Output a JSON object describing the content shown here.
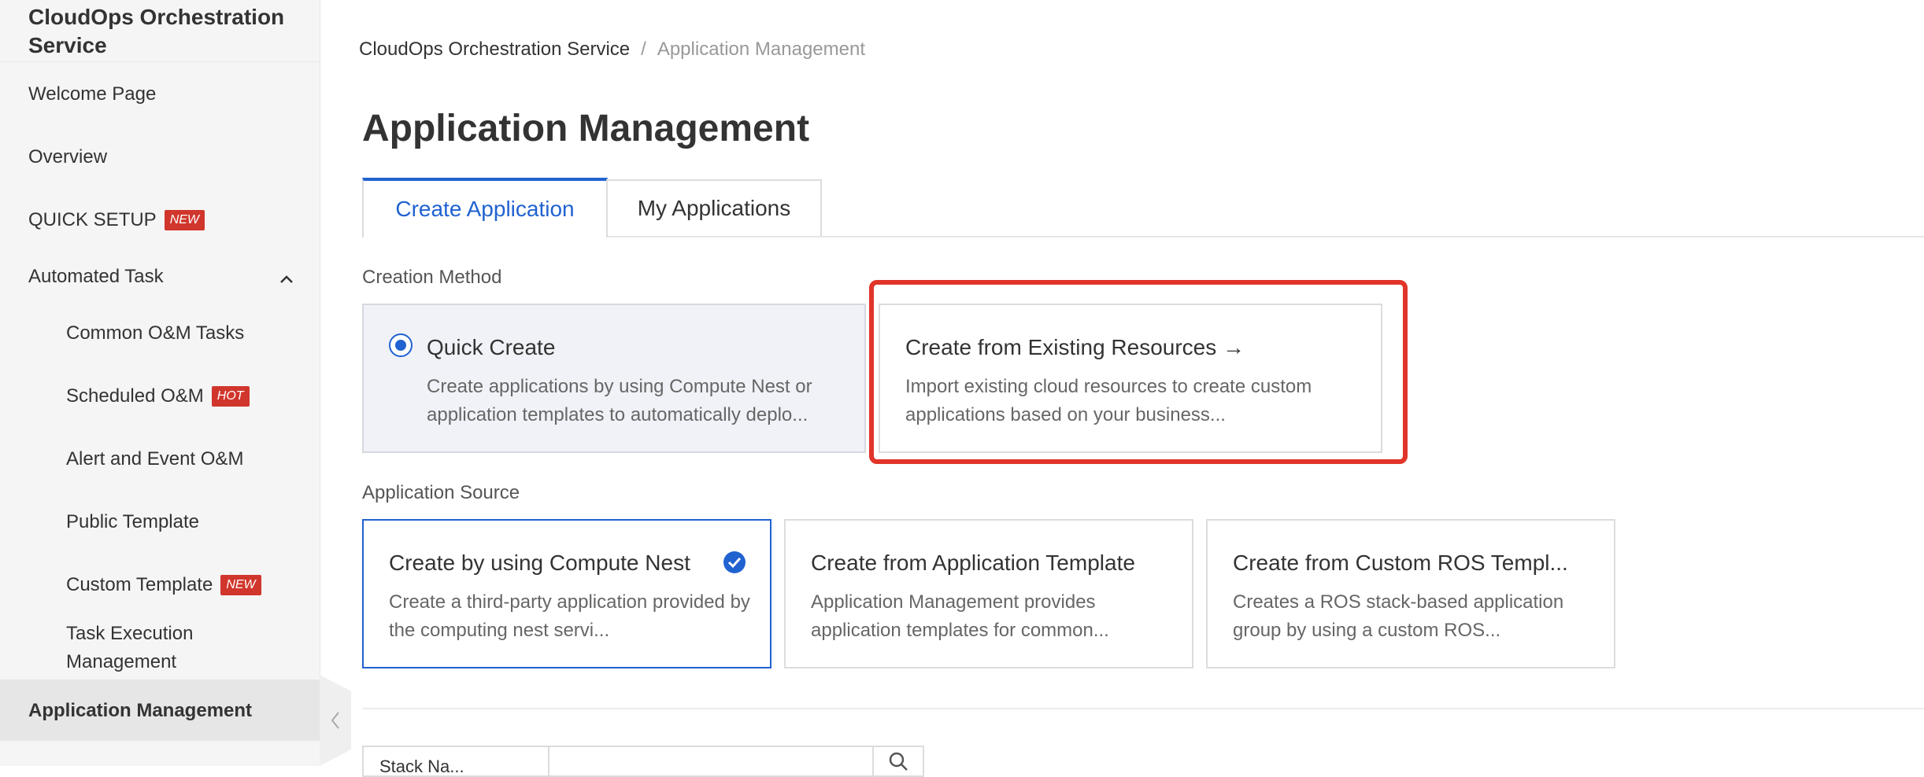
{
  "sidebar": {
    "app_title": "CloudOps Orchestration Service",
    "items": [
      {
        "label": "Welcome Page"
      },
      {
        "label": "Overview"
      },
      {
        "label": "QUICK SETUP",
        "badge": "NEW"
      },
      {
        "label": "Automated Task"
      },
      {
        "label": "Common O&M Tasks"
      },
      {
        "label": "Scheduled O&M",
        "badge": "HOT"
      },
      {
        "label": "Alert and Event O&M"
      },
      {
        "label": "Public Template"
      },
      {
        "label": "Custom Template",
        "badge": "NEW"
      },
      {
        "label": "Task Execution Management"
      },
      {
        "label": "Application Management"
      }
    ]
  },
  "breadcrumb": {
    "root": "CloudOps Orchestration Service",
    "separator": "/",
    "current": "Application Management"
  },
  "page": {
    "title": "Application Management"
  },
  "tabs": [
    {
      "label": "Create Application",
      "active": true
    },
    {
      "label": "My Applications",
      "active": false
    }
  ],
  "creation_method": {
    "label": "Creation Method",
    "options": [
      {
        "title": "Quick Create",
        "desc": "Create applications by using Compute Nest or application templates to automatically deplo..."
      },
      {
        "title": "Create from Existing Resources →",
        "desc": "Import existing cloud resources to create custom applications based on your business..."
      }
    ]
  },
  "application_source": {
    "label": "Application Source",
    "options": [
      {
        "title": "Create by using Compute Nest",
        "desc": "Create a third-party application provided by the computing nest servi..."
      },
      {
        "title": "Create from Application Template",
        "desc": "Application Management provides application templates for common..."
      },
      {
        "title": "Create from Custom ROS Templ...",
        "desc": "Creates a ROS stack-based application group by using a custom ROS..."
      }
    ]
  },
  "search": {
    "select_value": "Stack Na...",
    "placeholder": ""
  },
  "colors": {
    "accent": "#2062d0",
    "badge": "#d0362c",
    "highlight": "#e1352a"
  }
}
